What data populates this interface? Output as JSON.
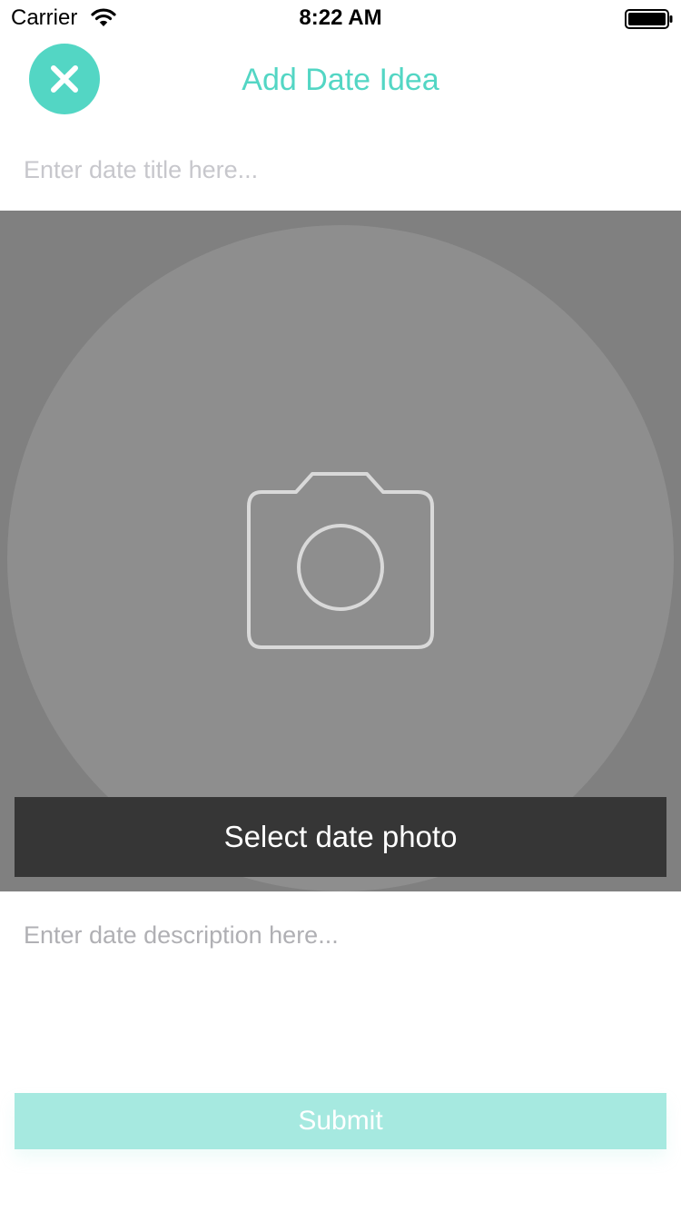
{
  "status_bar": {
    "carrier": "Carrier",
    "time": "8:22 AM",
    "icons": [
      "wifi-icon",
      "battery-icon"
    ]
  },
  "header": {
    "title": "Add Date Idea",
    "close_icon": "close-icon"
  },
  "form": {
    "title_placeholder": "Enter date title here...",
    "title_value": "",
    "photo_button_label": "Select date photo",
    "photo_icon": "camera-icon",
    "description_placeholder": "Enter date description here...",
    "description_value": "",
    "submit_label": "Submit"
  },
  "colors": {
    "accent": "#53d6c4",
    "submit_disabled": "#a6e9e0",
    "photo_background": "#808080",
    "photo_button_background": "#363636"
  }
}
